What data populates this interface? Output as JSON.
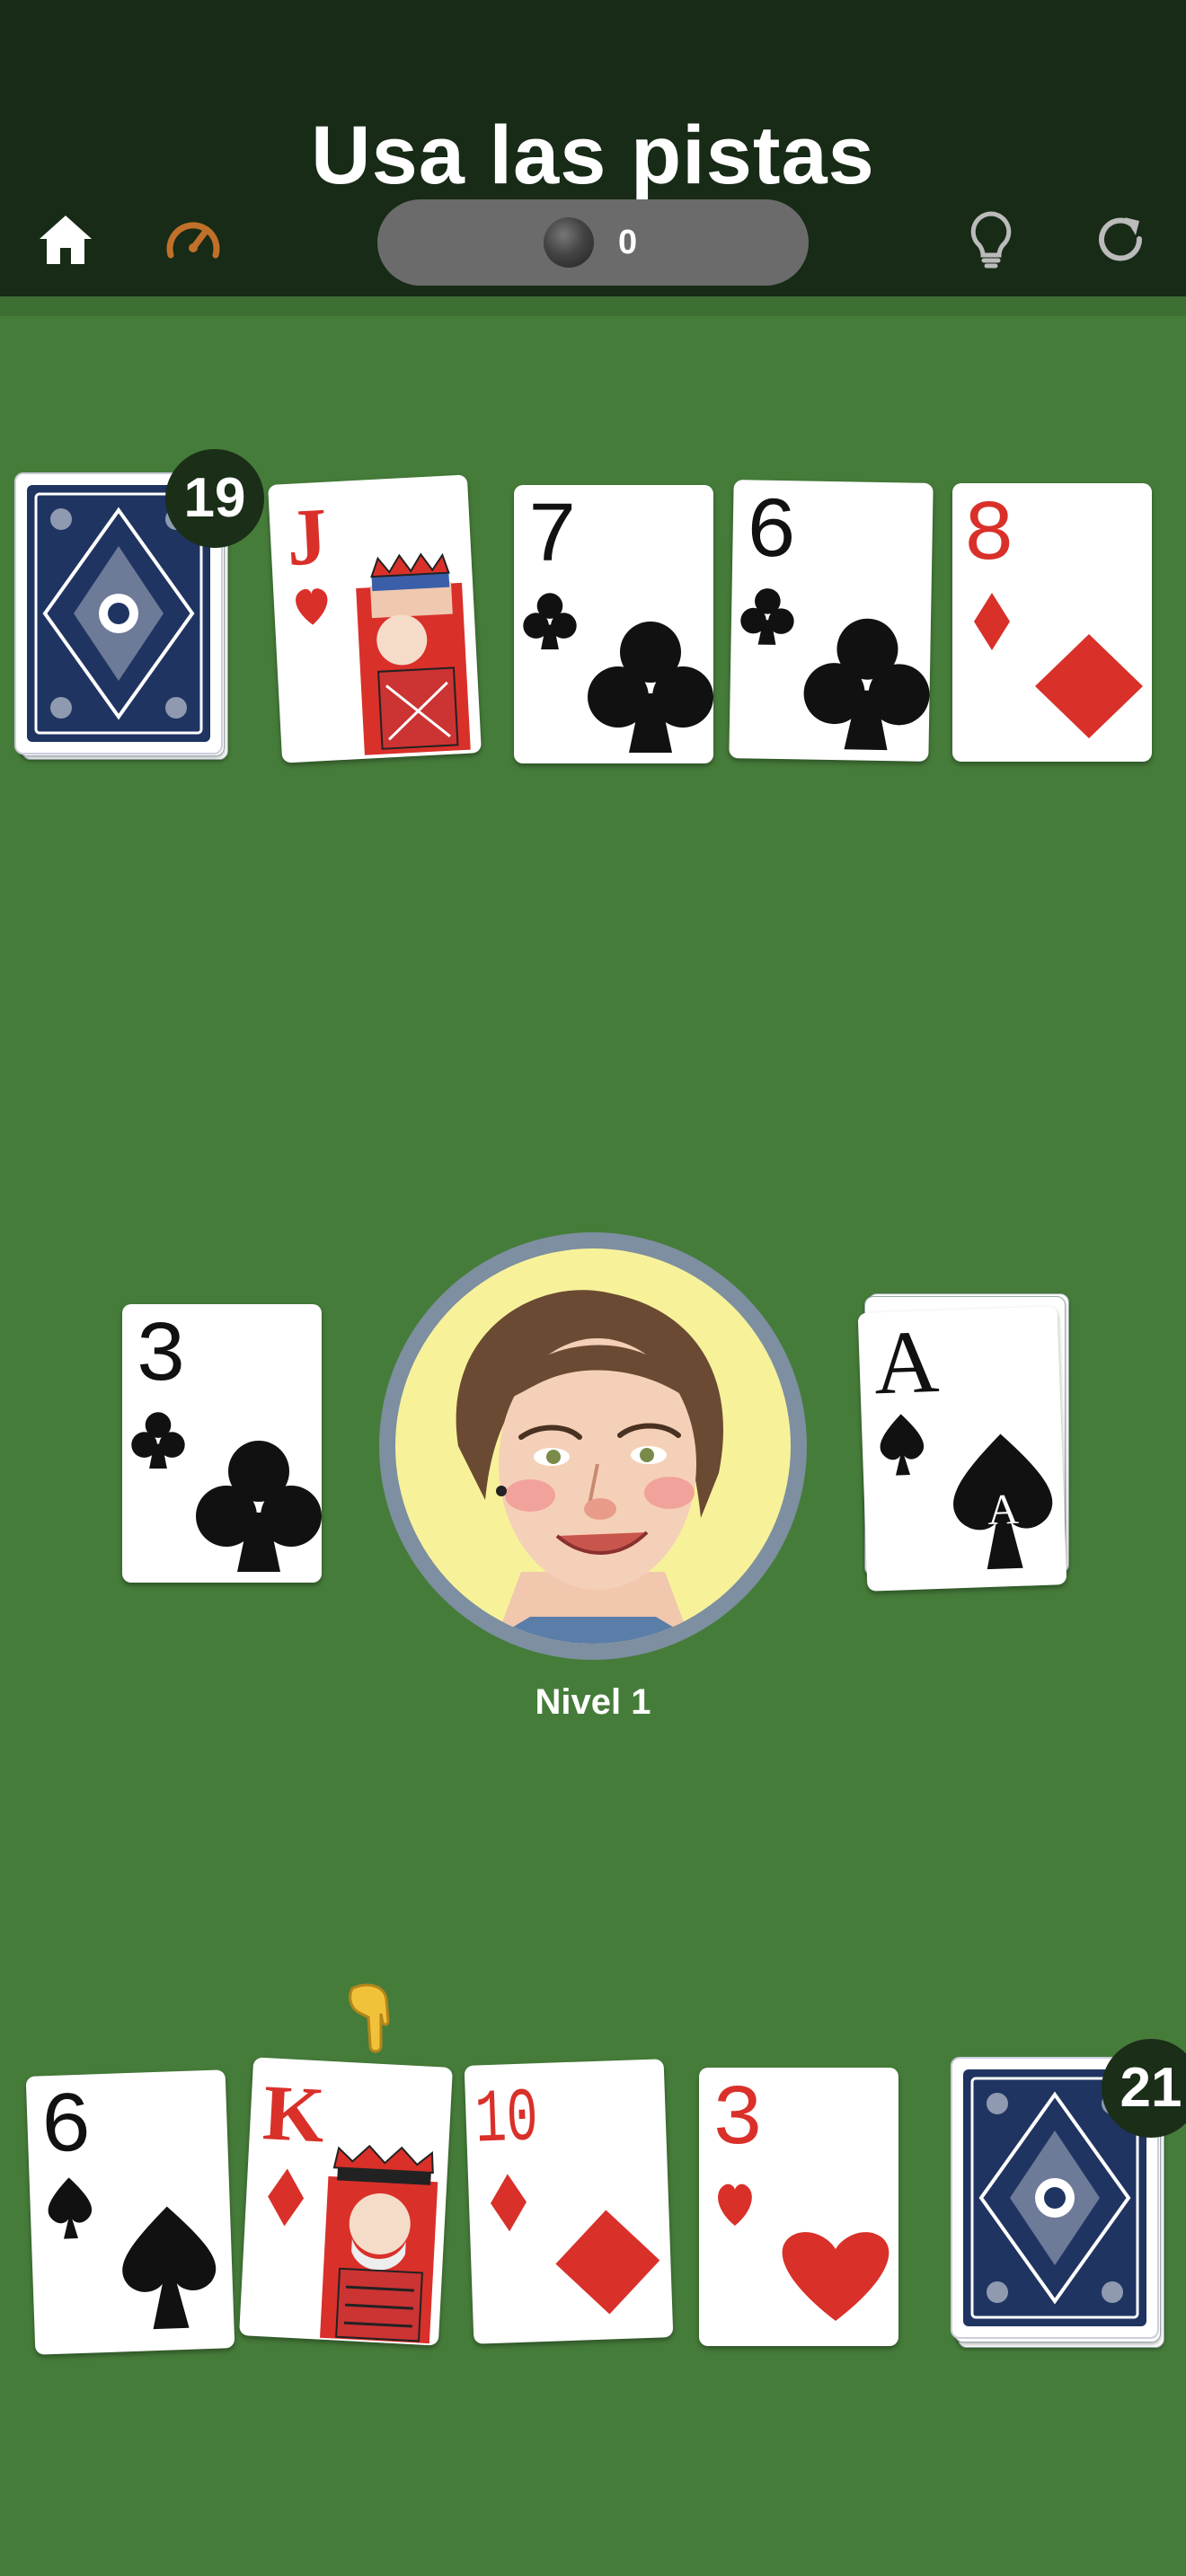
{
  "header": {
    "title": "Usa las pistas",
    "coins": "0",
    "icons": [
      "home-icon",
      "speedometer-icon",
      "lightbulb-icon",
      "refresh-icon"
    ]
  },
  "opponent": {
    "deck_count": "19",
    "hand": [
      {
        "rank": "J",
        "suit": "hearts"
      },
      {
        "rank": "7",
        "suit": "clubs"
      },
      {
        "rank": "6",
        "suit": "clubs"
      },
      {
        "rank": "8",
        "suit": "diamonds"
      }
    ]
  },
  "table": {
    "left_card": {
      "rank": "3",
      "suit": "clubs"
    },
    "right_card": {
      "rank": "A",
      "suit": "spades"
    },
    "level_label": "Nivel 1"
  },
  "player": {
    "deck_count": "21",
    "hand": [
      {
        "rank": "6",
        "suit": "spades"
      },
      {
        "rank": "K",
        "suit": "diamonds"
      },
      {
        "rank": "10",
        "suit": "diamonds"
      },
      {
        "rank": "3",
        "suit": "hearts"
      }
    ],
    "hinted_card": "K"
  },
  "colors": {
    "felt": "#467c3a",
    "header": "#172b16",
    "red_suit": "#d9302a",
    "black_suit": "#111111",
    "card_back": "#1f3461",
    "speed_icon": "#c0702a"
  }
}
